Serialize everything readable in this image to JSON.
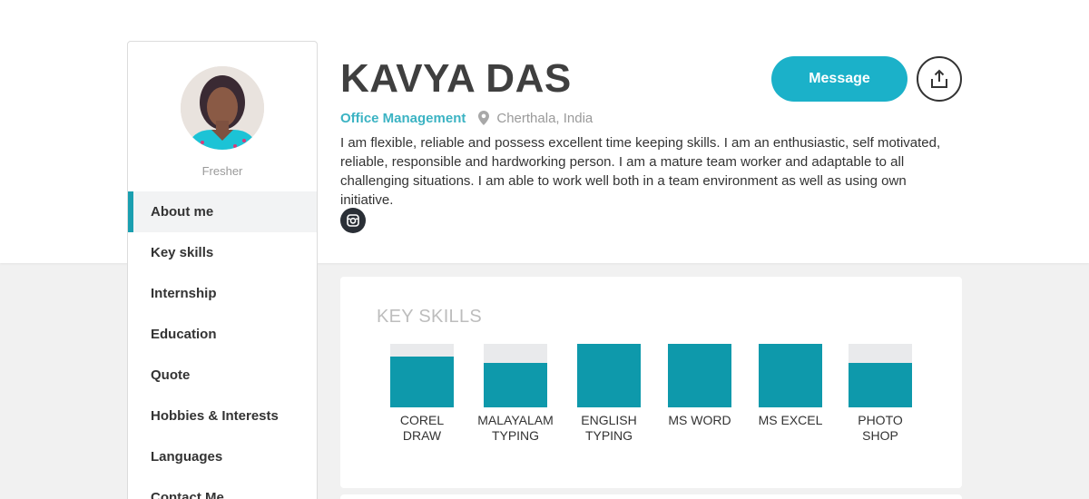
{
  "profile": {
    "name": "KAVYA DAS",
    "role": "Office Management",
    "location": "Cherthala, India",
    "status": "Fresher",
    "about": "I am flexible, reliable and possess excellent time keeping skills. I am an enthusiastic, self motivated, reliable, responsible and hardworking person. I am a mature team worker and adaptable to all challenging situations. I am able to work well both in a team environment as well as using own initiative."
  },
  "actions": {
    "message_label": "Message",
    "share_icon": "share-upload-icon",
    "instagram_icon": "instagram-icon"
  },
  "sidebar": {
    "items": [
      {
        "label": "About me",
        "active": true
      },
      {
        "label": "Key skills",
        "active": false
      },
      {
        "label": "Internship",
        "active": false
      },
      {
        "label": "Education",
        "active": false
      },
      {
        "label": "Quote",
        "active": false
      },
      {
        "label": "Hobbies & Interests",
        "active": false
      },
      {
        "label": "Languages",
        "active": false
      },
      {
        "label": "Contact Me",
        "active": false
      }
    ]
  },
  "key_skills": {
    "title": "KEY SKILLS",
    "skills": [
      {
        "line1": "COREL",
        "line2": "DRAW",
        "level": 0.8
      },
      {
        "line1": "MALAYALAM",
        "line2": "TYPING",
        "level": 0.7
      },
      {
        "line1": "ENGLISH",
        "line2": "TYPING",
        "level": 1.0
      },
      {
        "line1": "MS WORD",
        "line2": "",
        "level": 1.0
      },
      {
        "line1": "MS EXCEL",
        "line2": "",
        "level": 1.0
      },
      {
        "line1": "PHOTO",
        "line2": "SHOP",
        "level": 0.7
      }
    ]
  },
  "colors": {
    "accent": "#1bb1c9",
    "bar_fill": "#0e99ab",
    "bar_track": "#e9eaec",
    "role_text": "#3bb3c3"
  }
}
